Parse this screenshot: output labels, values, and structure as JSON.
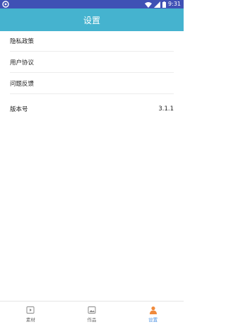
{
  "status_bar": {
    "time": "9:31",
    "left_icon": "app-notification-icon",
    "right_icons": [
      "wifi-icon",
      "signal-icon",
      "battery-icon"
    ],
    "color": "#3f51b5"
  },
  "header": {
    "title": "设置",
    "color": "#45b3cf"
  },
  "menu": {
    "items": [
      {
        "label": "隐私政策"
      },
      {
        "label": "用户协议"
      },
      {
        "label": "问题反馈"
      }
    ]
  },
  "version": {
    "label": "版本号",
    "value": "3.1.1"
  },
  "tabbar": {
    "tabs": [
      {
        "label": "素材",
        "icon": "play-icon",
        "active": false
      },
      {
        "label": "作品",
        "icon": "picture-icon",
        "active": false
      },
      {
        "label": "设置",
        "icon": "person-icon",
        "active": true
      }
    ],
    "active_color": "#f08a3c"
  }
}
